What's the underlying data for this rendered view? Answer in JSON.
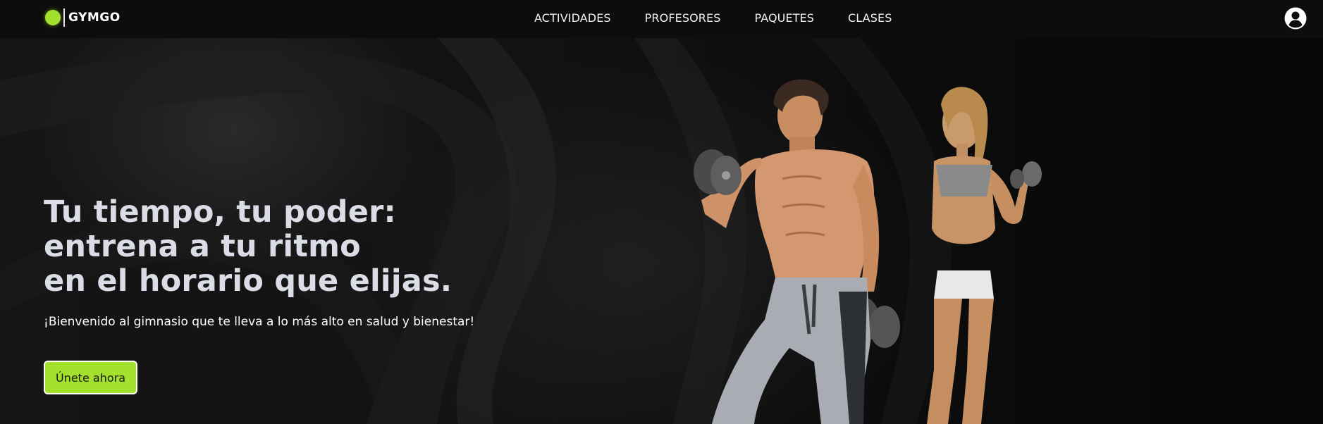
{
  "brand": {
    "name": "GYMGO",
    "accent_color": "#a4e12f"
  },
  "nav": {
    "items": [
      {
        "label": "ACTIVIDADES"
      },
      {
        "label": "PROFESORES"
      },
      {
        "label": "PAQUETES"
      },
      {
        "label": "CLASES"
      }
    ],
    "account_icon": "user-circle-icon"
  },
  "hero": {
    "headline": "Tu tiempo, tu poder:\nentrena a tu ritmo\nen el horario que elijas.",
    "subtitle": "¡Bienvenido al gimnasio que te lleva a lo más alto en salud y bienestar!",
    "cta_label": "Únete ahora",
    "image_subject": "two athletes lifting dumbbells"
  }
}
